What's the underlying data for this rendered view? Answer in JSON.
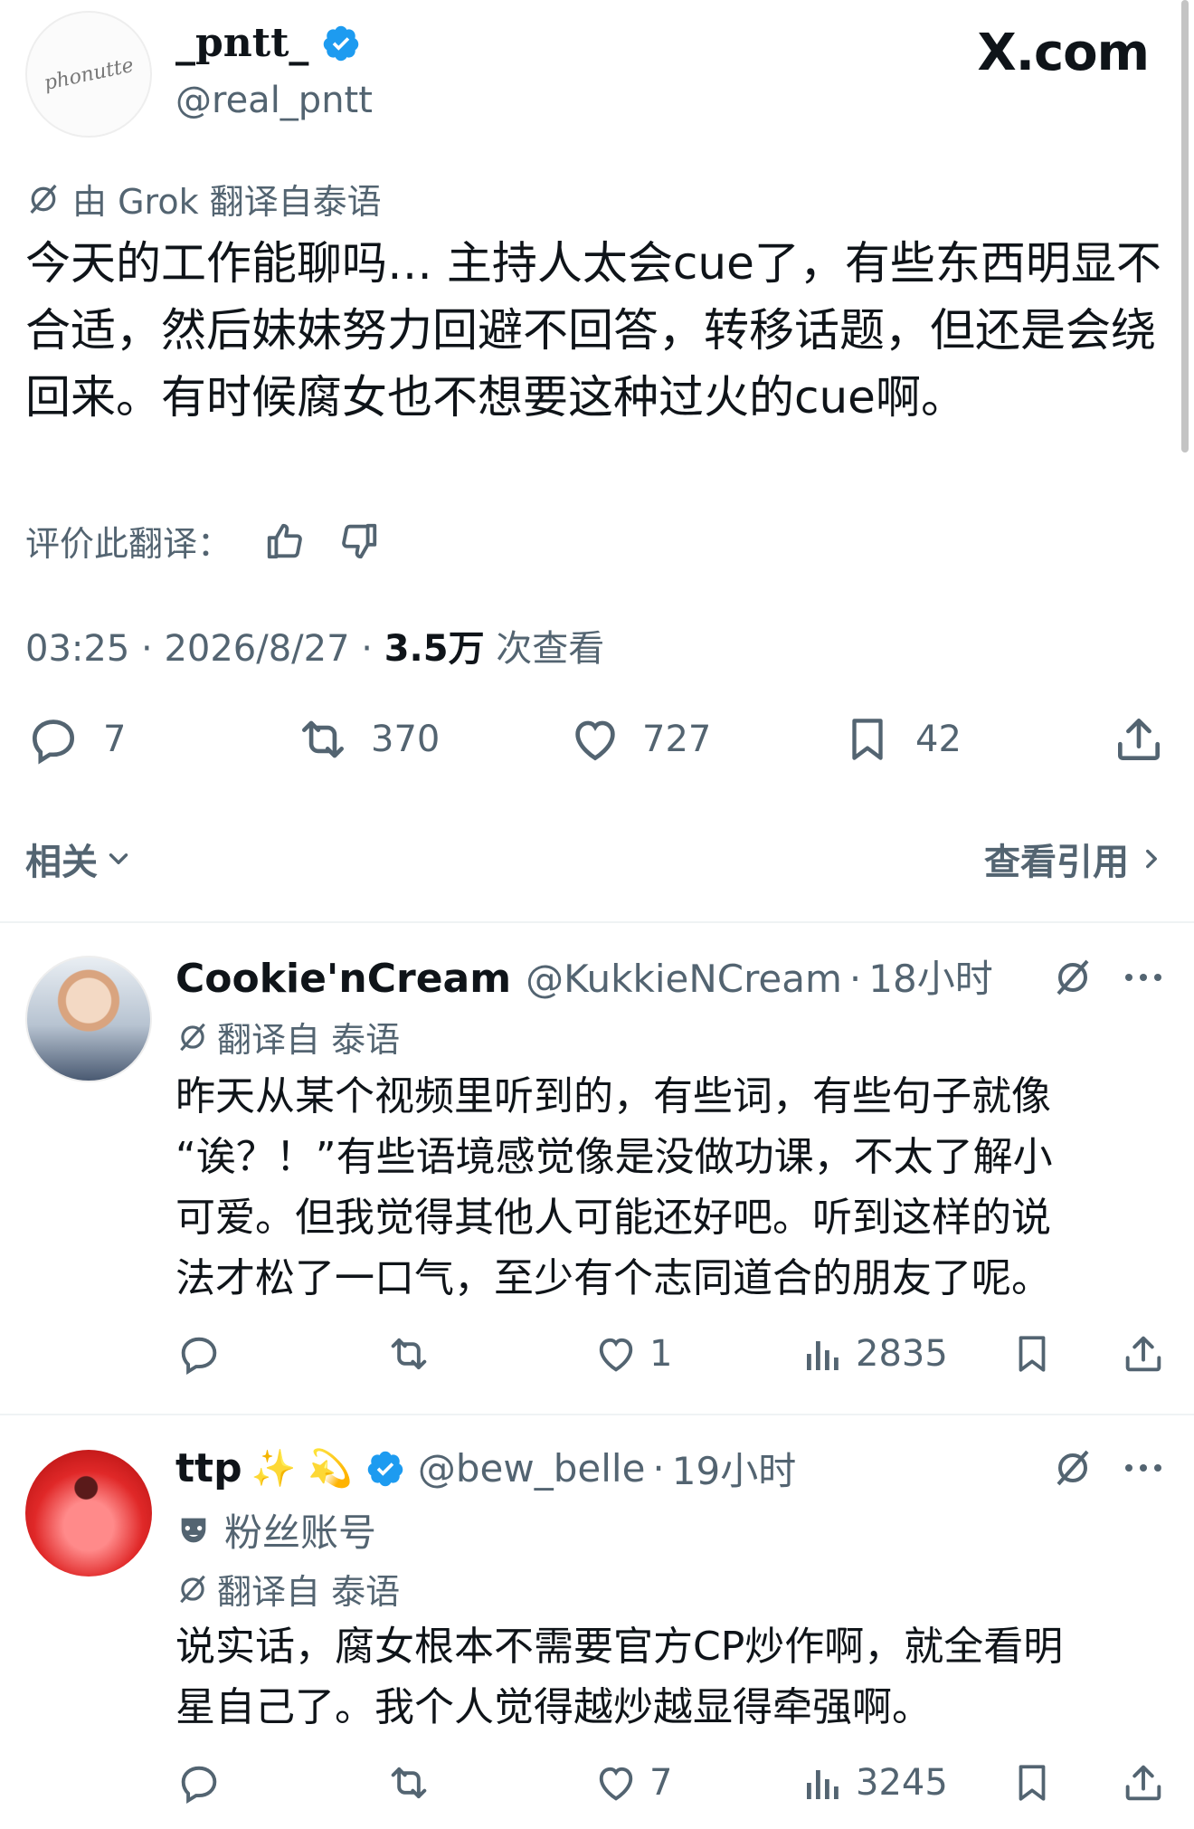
{
  "site_label": "X.com",
  "main_tweet": {
    "display_name": "_pntt_",
    "handle": "@real_pntt",
    "avatar_signature": "phonutte",
    "translation_note": "由 Grok 翻译自泰语",
    "body": "今天的工作能聊吗… 主持人太会cue了，有些东西明显不合适，然后妹妹努力回避不回答，转移话题，但还是会绕回来。有时候腐女也不想要这种过火的cue啊。",
    "rate_translation_label": "评价此翻译：",
    "time": "03:25",
    "date": "2026/8/27",
    "views_count": "3.5万",
    "views_label": "次查看",
    "separator": "·",
    "stats": {
      "replies": "7",
      "reposts": "370",
      "likes": "727",
      "bookmarks": "42"
    },
    "related_label": "相关",
    "view_quotes_label": "查看引用"
  },
  "replies": [
    {
      "display_name": "Cookie'nCream",
      "handle": "@KukkieNCream",
      "time": "18小时",
      "translation_note": "翻译自 泰语",
      "body_lines": [
        "昨天从某个视频里听到的，有些词，有些句子就像",
        "“诶？！”有些语境感觉像是没做功课，不太了解小",
        "可爱。但我觉得其他人可能还好吧。听到这样的说",
        "法才松了一口气，至少有个志同道合的朋友了呢。"
      ],
      "likes": "1",
      "views": "2835"
    },
    {
      "display_name": "ttp",
      "emoji": "✨ 💫",
      "handle": "@bew_belle",
      "time": "19小时",
      "account_label": "粉丝账号",
      "translation_note": "翻译自 泰语",
      "body_lines": [
        "说实话，腐女根本不需要官方CP炒作啊，就全看明",
        "星自己了。我个人觉得越炒越显得牵强啊。"
      ],
      "likes": "7",
      "views": "3245"
    }
  ],
  "colors": {
    "text": "#0f1419",
    "muted": "#536471",
    "verified": "#1d9bf0",
    "divider": "#eff3f4"
  }
}
